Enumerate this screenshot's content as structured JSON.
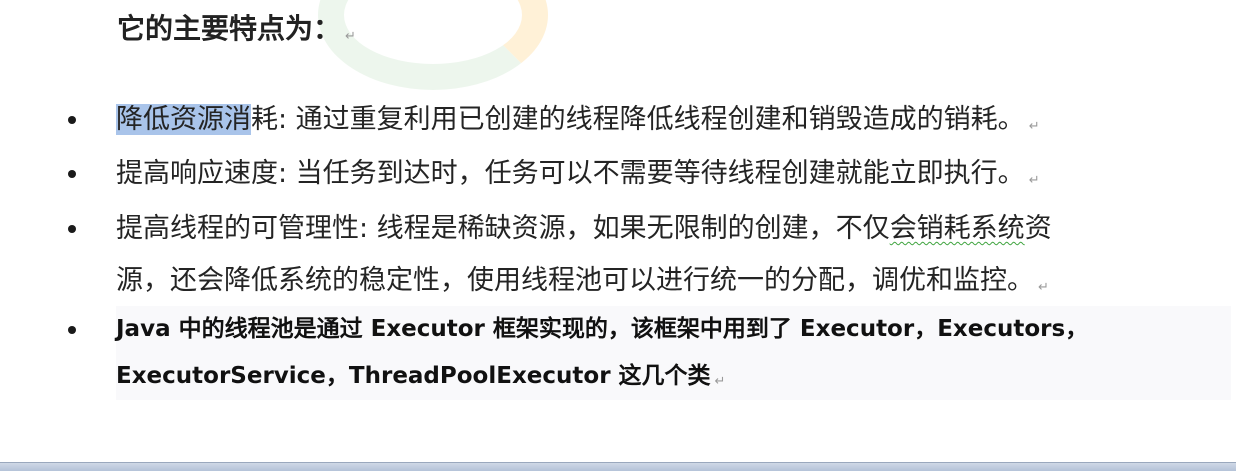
{
  "heading": "它的主要特点为：",
  "para_mark": "↵",
  "items": [
    {
      "term_selected": "降低资源消",
      "term_rest": "耗",
      "desc": ": 通过重复利用已创建的线程降低线程创建和销毁造成的销耗。"
    },
    {
      "term": "提高响应速度",
      "desc": ": 当任务到达时，任务可以不需要等待线程创建就能立即执行。"
    },
    {
      "line1_before": "提高线程的可管理性: 线程是稀缺资源，如果无限制的创建，不仅",
      "line1_wavy": "会销耗系统",
      "line1_after": "资",
      "line2": "源，还会降低系统的稳定性，使用线程池可以进行统一的分配，调优和监控。"
    },
    {
      "line1": "Java 中的线程池是通过 Executor 框架实现的，该框架中用到了 Executor，Executors，",
      "line2": "ExecutorService，ThreadPoolExecutor 这几个类"
    }
  ]
}
